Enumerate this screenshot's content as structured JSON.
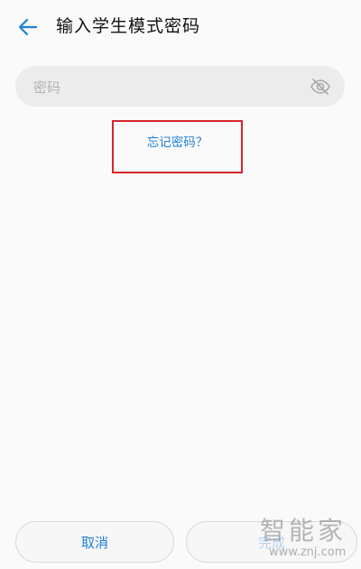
{
  "header": {
    "title": "输入学生模式密码",
    "back_icon": "arrow-left-icon",
    "accent_color": "#1f7fd6"
  },
  "password": {
    "placeholder": "密码",
    "value": "",
    "visibility_icon": "eye-off-icon"
  },
  "forgot_password": {
    "label": "忘记密码？",
    "highlight_color": "#d7242c"
  },
  "actions": {
    "cancel_label": "取消",
    "done_label": "完成",
    "done_enabled": false
  },
  "watermark": {
    "brand_text": "智能家",
    "url_text": "www.znj.com"
  }
}
